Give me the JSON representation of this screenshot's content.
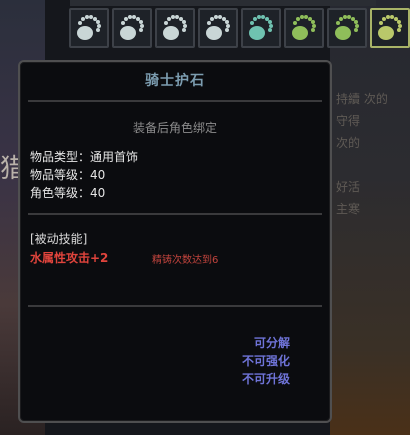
{
  "background": {
    "left_char": "猎",
    "right_fragments": [
      "持續 次的",
      "守得",
      "次的",
      "",
      "好活",
      "主寒",
      "",
      "",
      "",
      "",
      "",
      ""
    ]
  },
  "inventory_slots": [
    {
      "icon": "white-bead-bag-icon",
      "color": "#c9d6d6",
      "selected": false
    },
    {
      "icon": "white-bead-bag-icon",
      "color": "#c9d6d6",
      "selected": false
    },
    {
      "icon": "white-bead-bag-icon",
      "color": "#c9d6d6",
      "selected": false
    },
    {
      "icon": "white-bead-bag-icon",
      "color": "#c9d6d6",
      "selected": false
    },
    {
      "icon": "teal-bead-bag-icon",
      "color": "#6fc2b0",
      "selected": false
    },
    {
      "icon": "green-bead-bag-icon",
      "color": "#8fbe5a",
      "selected": false
    },
    {
      "icon": "green-bead-bag-icon",
      "color": "#8fbe5a",
      "selected": false
    },
    {
      "icon": "green-bead-bag-icon",
      "color": "#b9c86a",
      "selected": true
    }
  ],
  "tooltip": {
    "title": "骑士护石",
    "bind_note": "装备后角色绑定",
    "stats": [
      {
        "label": "物品类型：",
        "value": "通用首饰"
      },
      {
        "label": "物品等级：",
        "value": "40"
      },
      {
        "label": "角色等级：",
        "value": "40"
      }
    ],
    "skill_header": "[被动技能]",
    "skill_effect": "水属性攻击+2",
    "skill_condition": "精铸次数达到6",
    "flags": [
      "可分解",
      "不可强化",
      "不可升级"
    ]
  }
}
